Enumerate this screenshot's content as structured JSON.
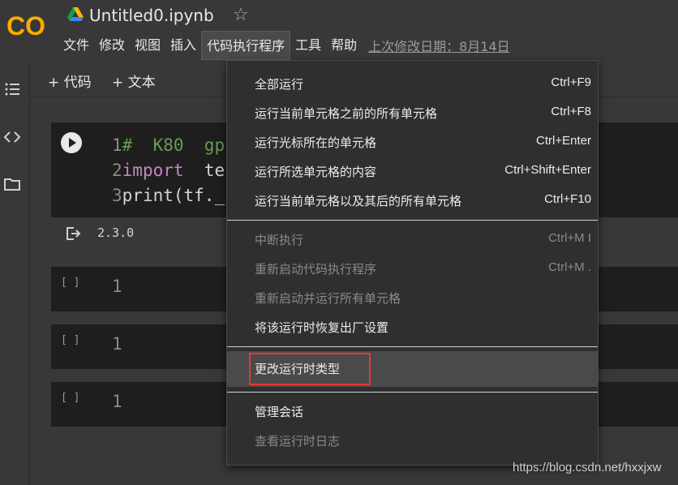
{
  "app": {
    "logo_text": "CO",
    "notebook_title": "Untitled0.ipynb",
    "last_edit": "上次修改日期：8月14日"
  },
  "menubar": [
    {
      "label": "文件"
    },
    {
      "label": "修改"
    },
    {
      "label": "视图"
    },
    {
      "label": "插入"
    },
    {
      "label": "代码执行程序",
      "active": true
    },
    {
      "label": "工具"
    },
    {
      "label": "帮助"
    }
  ],
  "toolbar": {
    "add_code": "+ 代码",
    "add_text": "+ 文本"
  },
  "cells": {
    "code_cell": {
      "lines": [
        {
          "num": "1",
          "parts": [
            {
              "cls": "cmt",
              "text": "#  K80  gp"
            }
          ]
        },
        {
          "num": "2",
          "parts": [
            {
              "cls": "kw",
              "text": "import"
            },
            {
              "cls": "plain",
              "text": "  te"
            }
          ]
        },
        {
          "num": "3",
          "parts": [
            {
              "cls": "plain",
              "text": "print(tf._"
            }
          ]
        }
      ],
      "output": "2.3.0"
    },
    "empty_cells": [
      {
        "bracket": "[ ]",
        "line": "1"
      },
      {
        "bracket": "[ ]",
        "line": "1"
      },
      {
        "bracket": "[ ]",
        "line": "1"
      }
    ]
  },
  "dropdown": {
    "groups": [
      [
        {
          "label": "全部运行",
          "shortcut": "Ctrl+F9",
          "disabled": false
        },
        {
          "label": "运行当前单元格之前的所有单元格",
          "shortcut": "Ctrl+F8",
          "disabled": false
        },
        {
          "label": "运行光标所在的单元格",
          "shortcut": "Ctrl+Enter",
          "disabled": false
        },
        {
          "label": "运行所选单元格的内容",
          "shortcut": "Ctrl+Shift+Enter",
          "disabled": false
        },
        {
          "label": "运行当前单元格以及其后的所有单元格",
          "shortcut": "Ctrl+F10",
          "disabled": false
        }
      ],
      [
        {
          "label": "中断执行",
          "shortcut": "Ctrl+M I",
          "disabled": true
        },
        {
          "label": "重新启动代码执行程序",
          "shortcut": "Ctrl+M .",
          "disabled": true
        },
        {
          "label": "重新启动并运行所有单元格",
          "shortcut": "",
          "disabled": true
        },
        {
          "label": "将该运行时恢复出厂设置",
          "shortcut": "",
          "disabled": false
        }
      ],
      [
        {
          "label": "更改运行时类型",
          "shortcut": "",
          "disabled": false,
          "highlighted": true
        }
      ],
      [
        {
          "label": "管理会话",
          "shortcut": "",
          "disabled": false
        },
        {
          "label": "查看运行时日志",
          "shortcut": "",
          "disabled": true
        }
      ]
    ]
  },
  "watermark": "https://blog.csdn.net/hxxjxw",
  "colors": {
    "logo_orange": "#f9ab00",
    "highlight_border": "#e53935",
    "comment_green": "#6a9955",
    "keyword_purple": "#c586c0"
  }
}
